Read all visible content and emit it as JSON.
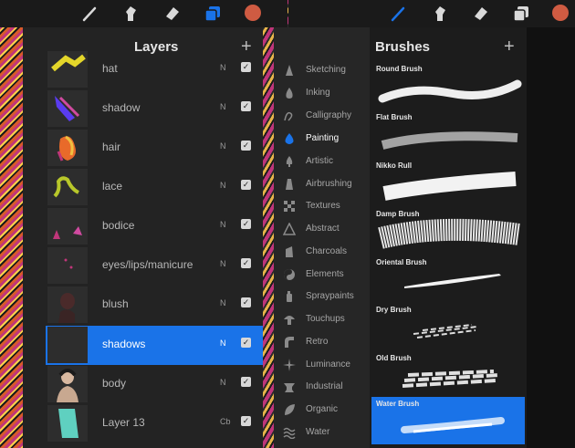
{
  "toolbar_left": {
    "tools": [
      {
        "icon": "brush-icon",
        "active": false
      },
      {
        "icon": "smudge-icon",
        "active": false
      },
      {
        "icon": "eraser-icon",
        "active": false
      },
      {
        "icon": "layers-icon",
        "active": true
      }
    ],
    "color": "#cf5b42"
  },
  "toolbar_right": {
    "tools": [
      {
        "icon": "brush-icon",
        "active": true
      },
      {
        "icon": "smudge-icon",
        "active": false
      },
      {
        "icon": "eraser-icon",
        "active": false
      },
      {
        "icon": "layers-icon",
        "active": false
      }
    ],
    "color": "#cf5b42"
  },
  "layers_panel": {
    "title": "Layers",
    "add_label": "+",
    "layers": [
      {
        "name": "hat",
        "blend": "N",
        "visible": true,
        "selected": false
      },
      {
        "name": "shadow",
        "blend": "N",
        "visible": true,
        "selected": false
      },
      {
        "name": "hair",
        "blend": "N",
        "visible": true,
        "selected": false
      },
      {
        "name": "lace",
        "blend": "N",
        "visible": true,
        "selected": false
      },
      {
        "name": "bodice",
        "blend": "N",
        "visible": true,
        "selected": false
      },
      {
        "name": "eyes/lips/manicure",
        "blend": "N",
        "visible": true,
        "selected": false
      },
      {
        "name": "blush",
        "blend": "N",
        "visible": true,
        "selected": false
      },
      {
        "name": "shadows",
        "blend": "N",
        "visible": true,
        "selected": true
      },
      {
        "name": "body",
        "blend": "N",
        "visible": true,
        "selected": false
      },
      {
        "name": "Layer 13",
        "blend": "Cb",
        "visible": true,
        "selected": false
      }
    ]
  },
  "brushes_panel": {
    "title": "Brushes",
    "add_label": "+",
    "categories": [
      {
        "label": "Sketching",
        "icon": "pencil-tip-icon"
      },
      {
        "label": "Inking",
        "icon": "ink-drop-icon"
      },
      {
        "label": "Calligraphy",
        "icon": "calligraphy-icon"
      },
      {
        "label": "Painting",
        "icon": "paint-drop-icon",
        "active": true
      },
      {
        "label": "Artistic",
        "icon": "artistic-icon"
      },
      {
        "label": "Airbrushing",
        "icon": "airbrush-icon"
      },
      {
        "label": "Textures",
        "icon": "texture-icon"
      },
      {
        "label": "Abstract",
        "icon": "triangle-icon"
      },
      {
        "label": "Charcoals",
        "icon": "charcoal-icon"
      },
      {
        "label": "Elements",
        "icon": "yin-yang-icon"
      },
      {
        "label": "Spraypaints",
        "icon": "spray-can-icon"
      },
      {
        "label": "Touchups",
        "icon": "mushroom-icon"
      },
      {
        "label": "Retro",
        "icon": "retro-icon"
      },
      {
        "label": "Luminance",
        "icon": "sparkle-icon"
      },
      {
        "label": "Industrial",
        "icon": "anvil-icon"
      },
      {
        "label": "Organic",
        "icon": "leaf-icon"
      },
      {
        "label": "Water",
        "icon": "waves-icon"
      }
    ],
    "brushes": [
      {
        "name": "Round Brush",
        "selected": false
      },
      {
        "name": "Flat Brush",
        "selected": false
      },
      {
        "name": "Nikko Rull",
        "selected": false
      },
      {
        "name": "Damp Brush",
        "selected": false
      },
      {
        "name": "Oriental Brush",
        "selected": false
      },
      {
        "name": "Dry Brush",
        "selected": false
      },
      {
        "name": "Old Brush",
        "selected": false
      },
      {
        "name": "Water Brush",
        "selected": true
      }
    ]
  },
  "colors": {
    "accent": "#1a73e8",
    "panel": "#232323",
    "toolbar": "#1a1a1a"
  }
}
